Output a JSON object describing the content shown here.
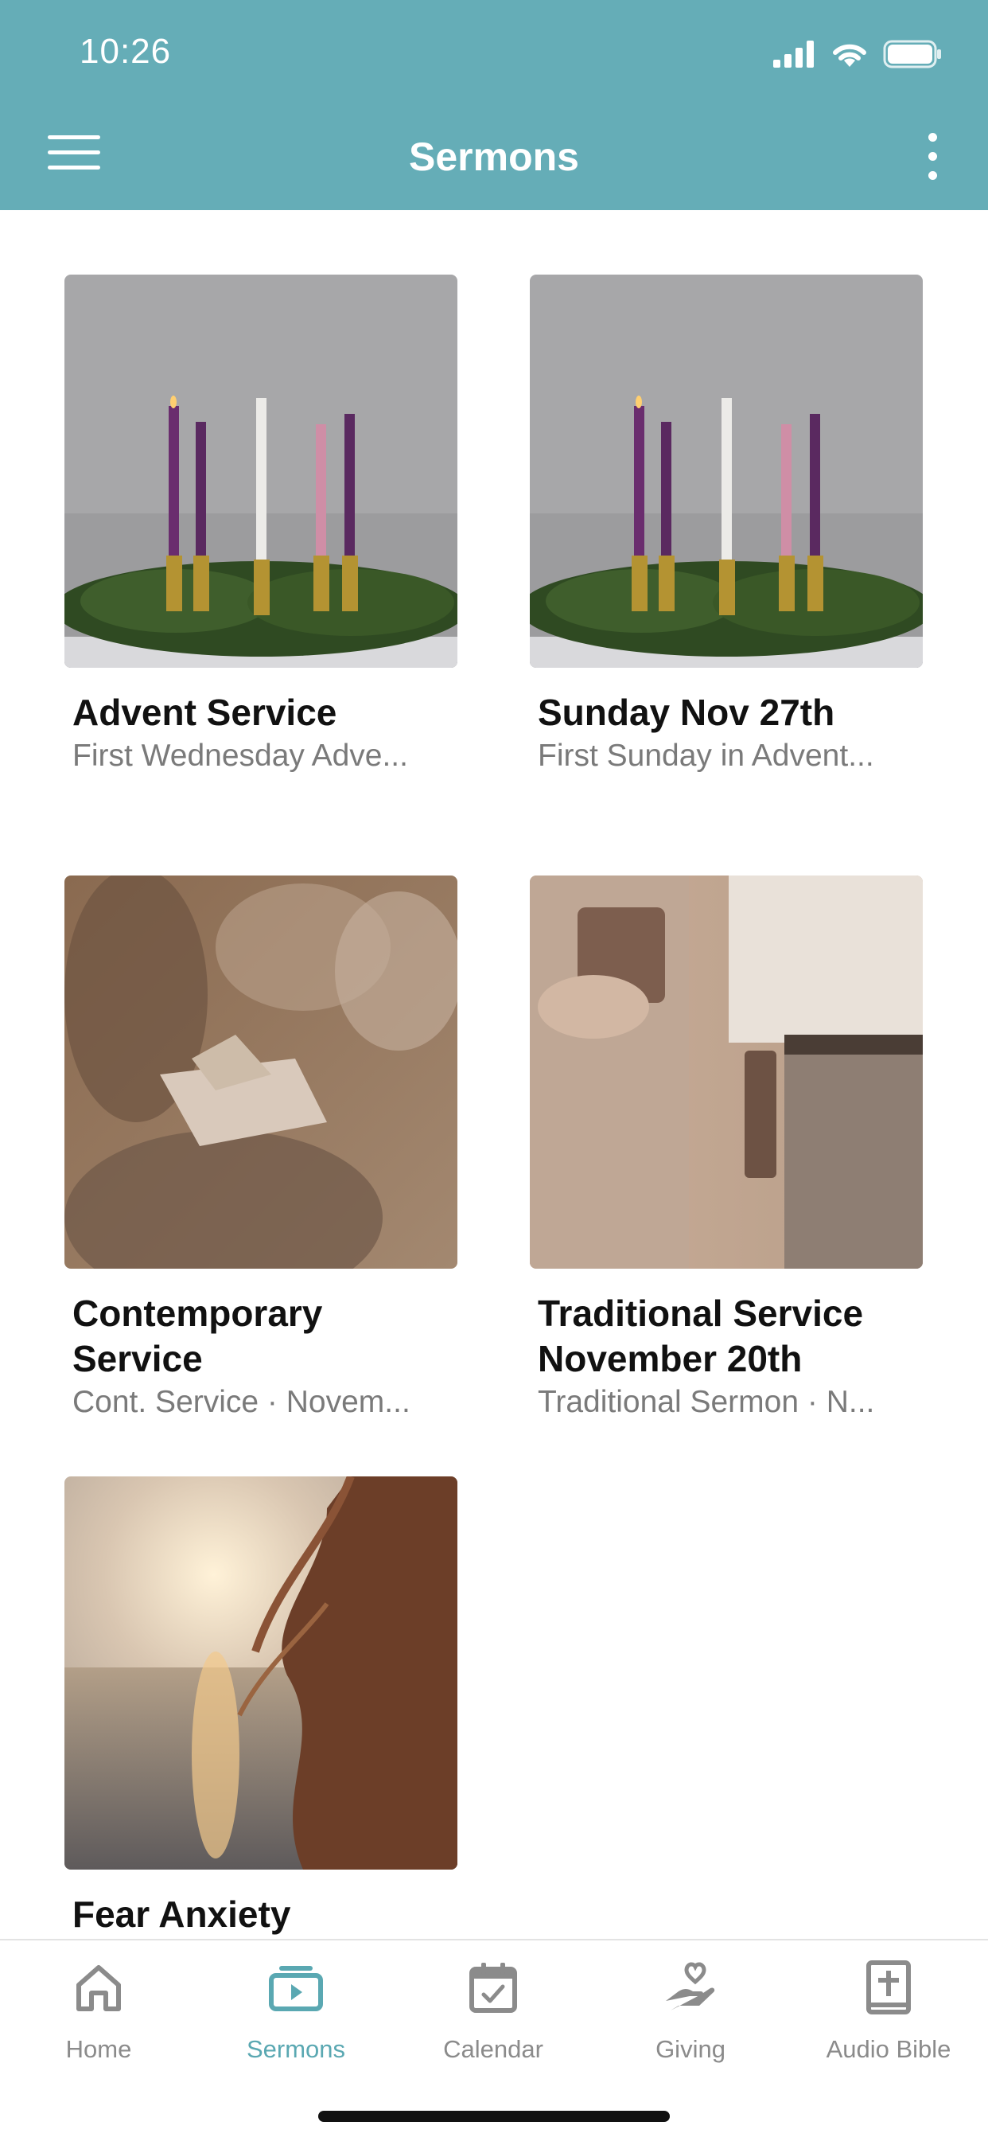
{
  "status_bar": {
    "time": "10:26"
  },
  "header": {
    "title": "Sermons"
  },
  "sermons": [
    {
      "title": "Advent Service",
      "subtitle": "First Wednesday Adve..."
    },
    {
      "title": "Sunday Nov 27th",
      "subtitle": "First Sunday in Advent..."
    },
    {
      "title": "Contemporary Service",
      "subtitle": "Cont. Service · Novem..."
    },
    {
      "title": "Traditional Service November 20th",
      "subtitle": "Traditional Sermon · N..."
    },
    {
      "title": "Fear Anxiety",
      "subtitle": ""
    }
  ],
  "tabs": [
    {
      "label": "Home",
      "icon": "home-icon"
    },
    {
      "label": "Sermons",
      "icon": "sermons-icon",
      "active": true
    },
    {
      "label": "Calendar",
      "icon": "calendar-icon"
    },
    {
      "label": "Giving",
      "icon": "giving-icon"
    },
    {
      "label": "Audio Bible",
      "icon": "audio-bible-icon"
    }
  ],
  "colors": {
    "header": "#65adb7",
    "active_tab": "#5aa8b2",
    "inactive_tab": "#8b8b8b"
  }
}
